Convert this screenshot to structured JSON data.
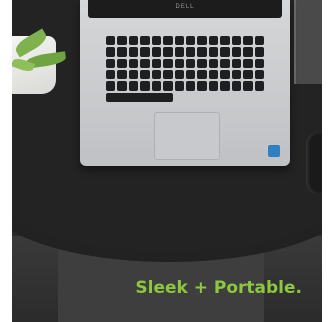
{
  "brand_mark": "DELL",
  "tagline": "Sleek + Portable.",
  "colors": {
    "tagline": "#8dc63f",
    "table": "#232323",
    "laptop": "#d6d7d9"
  },
  "icons": [
    "plant-icon",
    "laptop-icon",
    "mouse-icon",
    "notebook-icon"
  ]
}
